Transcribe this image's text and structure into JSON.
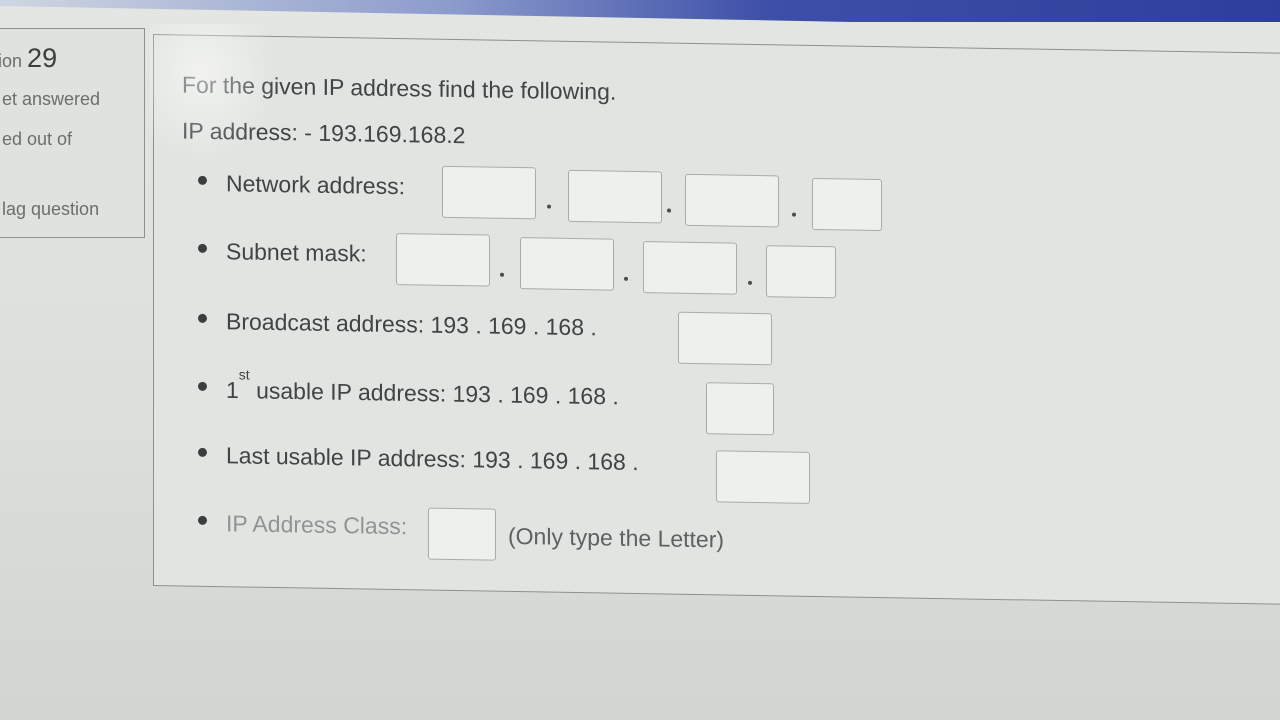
{
  "sidebar": {
    "question_prefix": "ion",
    "question_number": "29",
    "status": "et answered",
    "marked": "ed out of",
    "flag": "lag question"
  },
  "question": {
    "intro": "For the given IP address find the following.",
    "ip_label": "IP address: - 193.169.168.2",
    "network_label": "Network address:",
    "subnet_label": "Subnet mask:",
    "broadcast_label": "Broadcast address: 193 . 169 . 168 .",
    "first_usable_num": "1",
    "first_usable_sup": "st",
    "first_usable_label": "usable IP address: 193 . 169 . 168 .",
    "last_usable_label": "Last usable IP address: 193 . 169 . 168 .",
    "class_label": "IP Address Class:",
    "class_hint": "(Only type the Letter)"
  },
  "inputs": {
    "network": [
      "",
      "",
      "",
      ""
    ],
    "subnet": [
      "",
      "",
      "",
      ""
    ],
    "broadcast_last": "",
    "first_last": "",
    "last_last": "",
    "class": ""
  },
  "colors": {
    "background": "#dcdfdb",
    "text": "#3f4444",
    "accent_bar": "#2d3f9b"
  }
}
